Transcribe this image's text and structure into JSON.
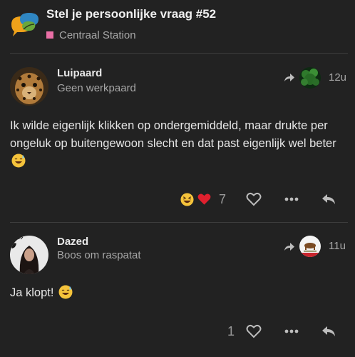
{
  "header": {
    "title": "Stel je persoonlijke vraag #52",
    "category": "Centraal Station",
    "category_color": "#e96fa6"
  },
  "posts": [
    {
      "username": "Luipaard",
      "user_title": "Geen werkpaard",
      "time": "12u",
      "body": "Ik wilde eigenlijk klikken op ondergemiddeld, maar drukte per ongeluk op buitengewoon slecht en dat past eigenlijk wel beter",
      "body_emoji": "sweat-smile-emoji",
      "reactions": [
        "grinning-squint-emoji",
        "red-heart-emoji"
      ],
      "like_count": "7"
    },
    {
      "username": "Dazed",
      "user_title": "Boos om raspatat",
      "time": "11u",
      "body": "Ja klopt!",
      "body_emoji": "sweat-smile-emoji",
      "like_count": "1"
    }
  ]
}
